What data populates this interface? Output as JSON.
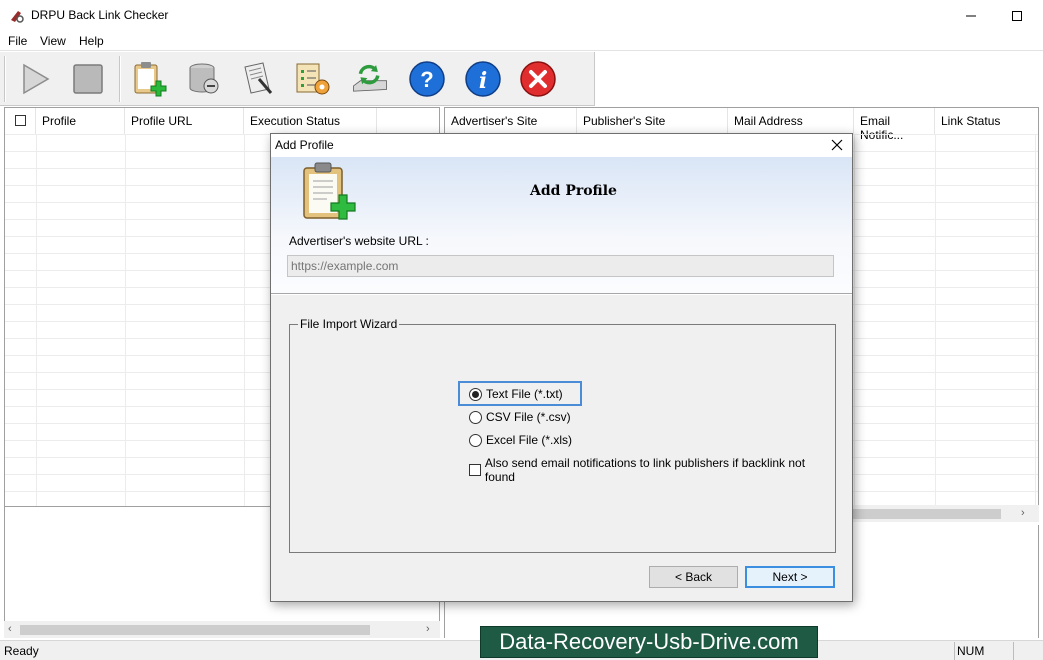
{
  "window": {
    "title": "DRPU Back Link Checker",
    "minimize": "–",
    "maximize": "☐"
  },
  "menu": [
    "File",
    "View",
    "Help"
  ],
  "toolbar": {
    "buttons": [
      "play-icon",
      "stop-icon",
      "add-profile-icon",
      "database-icon",
      "report-icon",
      "settings-checklist-icon",
      "refresh-drive-icon",
      "help-icon",
      "info-icon",
      "exit-icon"
    ]
  },
  "left_table": {
    "columns": [
      "Profile",
      "Profile URL",
      "Execution Status"
    ]
  },
  "right_table": {
    "columns": [
      "Advertiser's Site",
      "Publisher's Site",
      "Mail Address",
      "Email Notific...",
      "Link Status"
    ]
  },
  "dialog": {
    "title": "Add Profile",
    "close": "✕",
    "heading": "Add Profile",
    "url_label": "Advertiser's website URL :",
    "url_placeholder": "https://example.com",
    "group_title": "File Import Wizard",
    "options": [
      {
        "label": "Text File (*.txt)",
        "selected": true
      },
      {
        "label": "CSV File (*.csv)",
        "selected": false
      },
      {
        "label": "Excel File (*.xls)",
        "selected": false
      }
    ],
    "email_checkbox": {
      "label": "Also send email notifications to link publishers if backlink not found",
      "checked": false
    },
    "back_label": "< Back",
    "next_label": "Next >"
  },
  "status": {
    "text": "Ready",
    "num": "NUM"
  },
  "watermark": "Data-Recovery-Usb-Drive.com",
  "colors": {
    "accent_focus": "#3c8ee0",
    "watermark_bg": "#1e5a44"
  }
}
